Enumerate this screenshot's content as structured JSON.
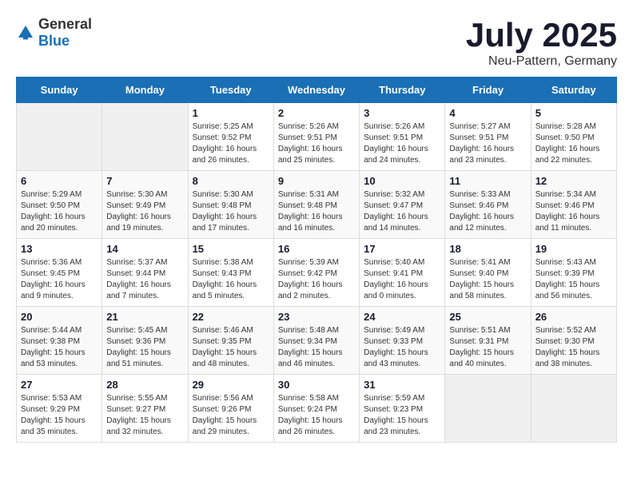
{
  "header": {
    "logo_general": "General",
    "logo_blue": "Blue",
    "month_title": "July 2025",
    "subtitle": "Neu-Pattern, Germany"
  },
  "weekdays": [
    "Sunday",
    "Monday",
    "Tuesday",
    "Wednesday",
    "Thursday",
    "Friday",
    "Saturday"
  ],
  "weeks": [
    [
      {
        "day": "",
        "detail": ""
      },
      {
        "day": "",
        "detail": ""
      },
      {
        "day": "1",
        "detail": "Sunrise: 5:25 AM\nSunset: 9:52 PM\nDaylight: 16 hours\nand 26 minutes."
      },
      {
        "day": "2",
        "detail": "Sunrise: 5:26 AM\nSunset: 9:51 PM\nDaylight: 16 hours\nand 25 minutes."
      },
      {
        "day": "3",
        "detail": "Sunrise: 5:26 AM\nSunset: 9:51 PM\nDaylight: 16 hours\nand 24 minutes."
      },
      {
        "day": "4",
        "detail": "Sunrise: 5:27 AM\nSunset: 9:51 PM\nDaylight: 16 hours\nand 23 minutes."
      },
      {
        "day": "5",
        "detail": "Sunrise: 5:28 AM\nSunset: 9:50 PM\nDaylight: 16 hours\nand 22 minutes."
      }
    ],
    [
      {
        "day": "6",
        "detail": "Sunrise: 5:29 AM\nSunset: 9:50 PM\nDaylight: 16 hours\nand 20 minutes."
      },
      {
        "day": "7",
        "detail": "Sunrise: 5:30 AM\nSunset: 9:49 PM\nDaylight: 16 hours\nand 19 minutes."
      },
      {
        "day": "8",
        "detail": "Sunrise: 5:30 AM\nSunset: 9:48 PM\nDaylight: 16 hours\nand 17 minutes."
      },
      {
        "day": "9",
        "detail": "Sunrise: 5:31 AM\nSunset: 9:48 PM\nDaylight: 16 hours\nand 16 minutes."
      },
      {
        "day": "10",
        "detail": "Sunrise: 5:32 AM\nSunset: 9:47 PM\nDaylight: 16 hours\nand 14 minutes."
      },
      {
        "day": "11",
        "detail": "Sunrise: 5:33 AM\nSunset: 9:46 PM\nDaylight: 16 hours\nand 12 minutes."
      },
      {
        "day": "12",
        "detail": "Sunrise: 5:34 AM\nSunset: 9:46 PM\nDaylight: 16 hours\nand 11 minutes."
      }
    ],
    [
      {
        "day": "13",
        "detail": "Sunrise: 5:36 AM\nSunset: 9:45 PM\nDaylight: 16 hours\nand 9 minutes."
      },
      {
        "day": "14",
        "detail": "Sunrise: 5:37 AM\nSunset: 9:44 PM\nDaylight: 16 hours\nand 7 minutes."
      },
      {
        "day": "15",
        "detail": "Sunrise: 5:38 AM\nSunset: 9:43 PM\nDaylight: 16 hours\nand 5 minutes."
      },
      {
        "day": "16",
        "detail": "Sunrise: 5:39 AM\nSunset: 9:42 PM\nDaylight: 16 hours\nand 2 minutes."
      },
      {
        "day": "17",
        "detail": "Sunrise: 5:40 AM\nSunset: 9:41 PM\nDaylight: 16 hours\nand 0 minutes."
      },
      {
        "day": "18",
        "detail": "Sunrise: 5:41 AM\nSunset: 9:40 PM\nDaylight: 15 hours\nand 58 minutes."
      },
      {
        "day": "19",
        "detail": "Sunrise: 5:43 AM\nSunset: 9:39 PM\nDaylight: 15 hours\nand 56 minutes."
      }
    ],
    [
      {
        "day": "20",
        "detail": "Sunrise: 5:44 AM\nSunset: 9:38 PM\nDaylight: 15 hours\nand 53 minutes."
      },
      {
        "day": "21",
        "detail": "Sunrise: 5:45 AM\nSunset: 9:36 PM\nDaylight: 15 hours\nand 51 minutes."
      },
      {
        "day": "22",
        "detail": "Sunrise: 5:46 AM\nSunset: 9:35 PM\nDaylight: 15 hours\nand 48 minutes."
      },
      {
        "day": "23",
        "detail": "Sunrise: 5:48 AM\nSunset: 9:34 PM\nDaylight: 15 hours\nand 46 minutes."
      },
      {
        "day": "24",
        "detail": "Sunrise: 5:49 AM\nSunset: 9:33 PM\nDaylight: 15 hours\nand 43 minutes."
      },
      {
        "day": "25",
        "detail": "Sunrise: 5:51 AM\nSunset: 9:31 PM\nDaylight: 15 hours\nand 40 minutes."
      },
      {
        "day": "26",
        "detail": "Sunrise: 5:52 AM\nSunset: 9:30 PM\nDaylight: 15 hours\nand 38 minutes."
      }
    ],
    [
      {
        "day": "27",
        "detail": "Sunrise: 5:53 AM\nSunset: 9:29 PM\nDaylight: 15 hours\nand 35 minutes."
      },
      {
        "day": "28",
        "detail": "Sunrise: 5:55 AM\nSunset: 9:27 PM\nDaylight: 15 hours\nand 32 minutes."
      },
      {
        "day": "29",
        "detail": "Sunrise: 5:56 AM\nSunset: 9:26 PM\nDaylight: 15 hours\nand 29 minutes."
      },
      {
        "day": "30",
        "detail": "Sunrise: 5:58 AM\nSunset: 9:24 PM\nDaylight: 15 hours\nand 26 minutes."
      },
      {
        "day": "31",
        "detail": "Sunrise: 5:59 AM\nSunset: 9:23 PM\nDaylight: 15 hours\nand 23 minutes."
      },
      {
        "day": "",
        "detail": ""
      },
      {
        "day": "",
        "detail": ""
      }
    ]
  ]
}
